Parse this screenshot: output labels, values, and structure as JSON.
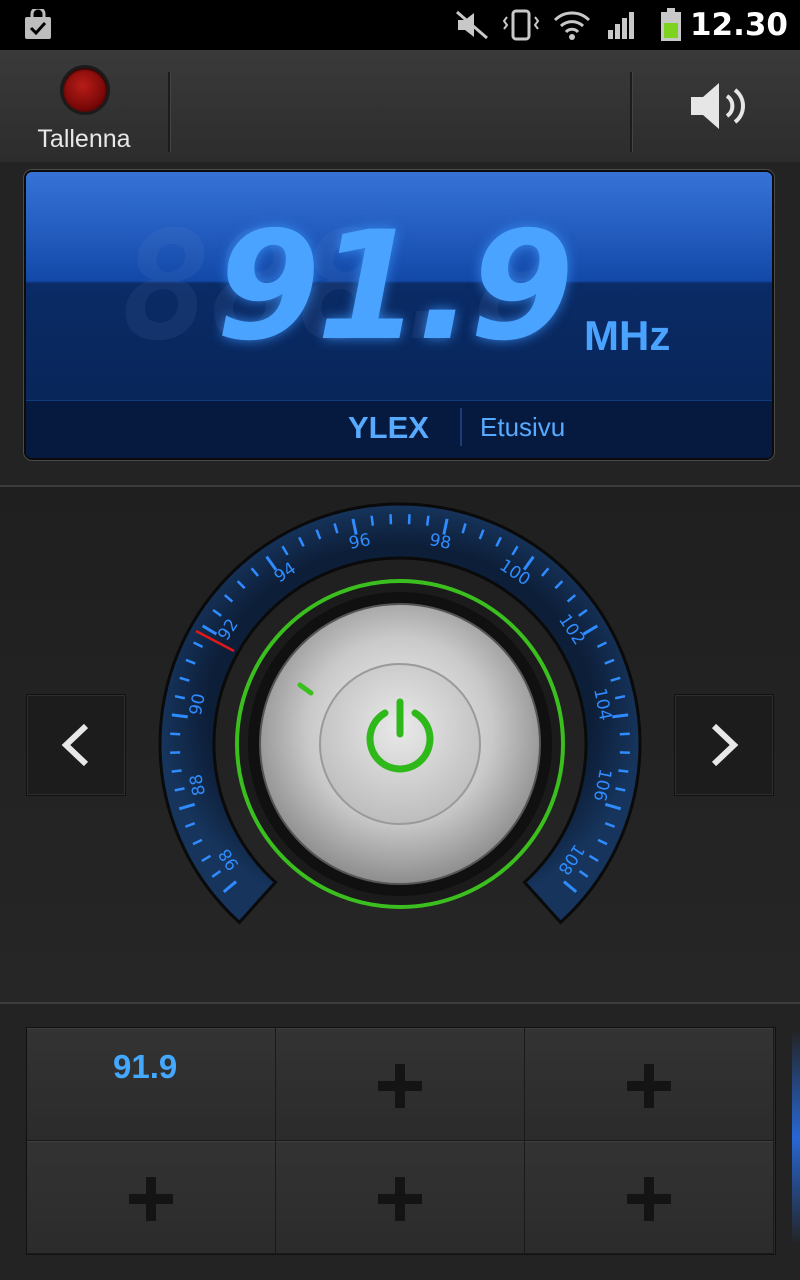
{
  "status_bar": {
    "time": "12.30",
    "icons": [
      "store-notification-icon",
      "mute-icon",
      "vibrate-icon",
      "wifi-icon",
      "signal-icon",
      "battery-icon"
    ]
  },
  "toolbar": {
    "record_label": "Tallenna",
    "speaker_icon": "speaker-icon"
  },
  "display": {
    "frequency": "91.9",
    "frequency_ghost": "888.8",
    "unit": "MHz",
    "station": "YLEX",
    "home_link": "Etusivu"
  },
  "dial": {
    "labels": [
      "98",
      "88",
      "90",
      "92",
      "94",
      "96",
      "98",
      "100",
      "102",
      "104",
      "106",
      "108"
    ],
    "power_icon": "power-icon",
    "accent": "#2f8cff",
    "ring_color": "#3bbf1f"
  },
  "presets": {
    "items": [
      {
        "label": "91.9"
      },
      {
        "label": ""
      },
      {
        "label": ""
      },
      {
        "label": ""
      },
      {
        "label": ""
      },
      {
        "label": ""
      }
    ]
  }
}
